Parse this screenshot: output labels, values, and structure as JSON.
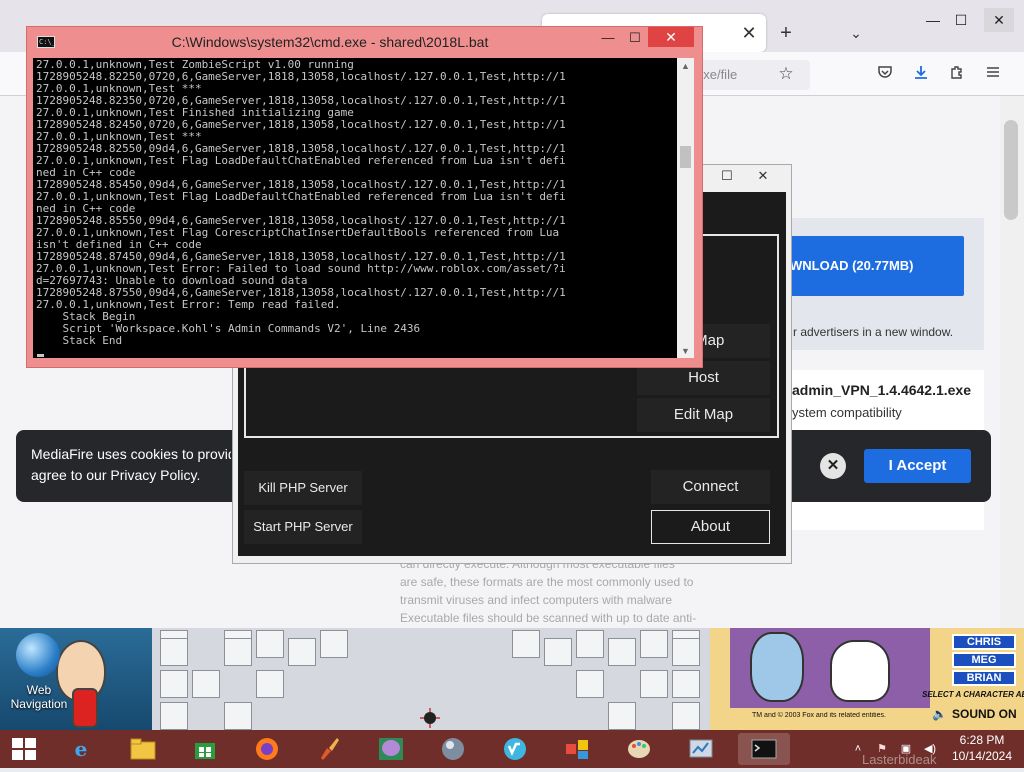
{
  "browser": {
    "tab_close": "✕",
    "tab_new": "+",
    "tab_list": "⌄",
    "url_fragment": "exe/file",
    "controls": {
      "minimize": "—",
      "maximize": "☐",
      "close": "✕"
    },
    "download_label": "WNLOAD (20.77MB)",
    "advertisers_note": "r advertisers in a new window.",
    "file_name": "admin_VPN_1.4.4642.1.exe",
    "file_compat": "ystem compatibility",
    "cookie_text_1": "MediaFire uses cookies to provide",
    "cookie_text_2": "agree to our Privacy Policy.",
    "cookie_close": "✕",
    "accept_label": "I Accept",
    "faded_lines": [
      "can directly execute. Although most executable files",
      "are safe, these formats are the most commonly used to",
      "transmit viruses and infect computers with malware",
      "Executable files should be scanned with up to date anti-"
    ]
  },
  "launcher": {
    "controls": {
      "maximize": "☐",
      "close": "✕"
    },
    "buttons": {
      "map": "e Map",
      "host": "Host",
      "edit_map": "Edit Map",
      "kill_php": "Kill PHP Server",
      "start_php": "Start PHP Server",
      "connect": "Connect",
      "about": "About"
    }
  },
  "cmd": {
    "icon_text": "C:\\_",
    "title": "C:\\Windows\\system32\\cmd.exe - shared\\2018L.bat",
    "controls": {
      "minimize": "—",
      "maximize": "☐",
      "close": "✕"
    },
    "scroll_up": "▲",
    "scroll_down": "▼",
    "lines": [
      "27.0.0.1,unknown,Test ZombieScript v1.00 running",
      "1728905248.82250,0720,6,GameServer,1818,13058,localhost/.127.0.0.1,Test,http://1",
      "27.0.0.1,unknown,Test ***",
      "1728905248.82350,0720,6,GameServer,1818,13058,localhost/.127.0.0.1,Test,http://1",
      "27.0.0.1,unknown,Test Finished initializing game",
      "1728905248.82450,0720,6,GameServer,1818,13058,localhost/.127.0.0.1,Test,http://1",
      "27.0.0.1,unknown,Test ***",
      "1728905248.82550,09d4,6,GameServer,1818,13058,localhost/.127.0.0.1,Test,http://1",
      "27.0.0.1,unknown,Test Flag LoadDefaultChatEnabled referenced from Lua isn't defi",
      "ned in C++ code",
      "1728905248.85450,09d4,6,GameServer,1818,13058,localhost/.127.0.0.1,Test,http://1",
      "27.0.0.1,unknown,Test Flag LoadDefaultChatEnabled referenced from Lua isn't defi",
      "ned in C++ code",
      "1728905248.85550,09d4,6,GameServer,1818,13058,localhost/.127.0.0.1,Test,http://1",
      "27.0.0.1,unknown,Test Flag CorescriptChatInsertDefaultBools referenced from Lua",
      "isn't defined in C++ code",
      "1728905248.87450,09d4,6,GameServer,1818,13058,localhost/.127.0.0.1,Test,http://1",
      "27.0.0.1,unknown,Test Error: Failed to load sound http://www.roblox.com/asset/?i",
      "d=27697743: Unable to download sound data",
      "1728905248.87550,09d4,6,GameServer,1818,13058,localhost/.127.0.0.1,Test,http://1",
      "27.0.0.1,unknown,Test Error: Temp read failed.",
      "    Stack Begin",
      "    Script 'Workspace.Kohl's Admin Commands V2', Line 2436",
      "    Stack End"
    ]
  },
  "desktop": {
    "icon_label": "Web Navigation",
    "characters": [
      "CHRIS",
      "MEG",
      "BRIAN"
    ],
    "select_text": "SELECT A CHARACTER ABOVE",
    "tm_text": "TM and © 2003 Fox and its related entities.",
    "sound_text": "SOUND ON"
  },
  "taskbar": {
    "tray": {
      "chevron": "˄",
      "flag": "⚑",
      "network": "▣",
      "volume": "◀)"
    },
    "time": "6:28 PM",
    "date": "10/14/2024",
    "watermark": "Lasterbideak"
  }
}
